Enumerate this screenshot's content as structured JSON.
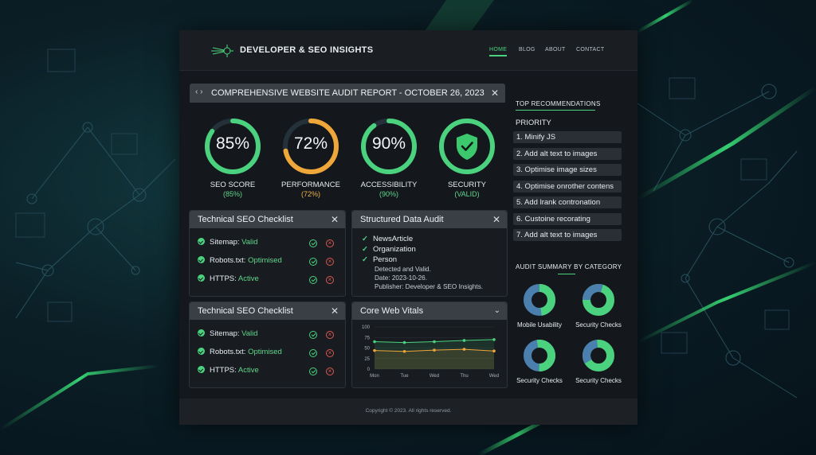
{
  "header": {
    "brand": "DEVELOPER & SEO INSIGHTS",
    "nav": [
      "HOME",
      "BLOG",
      "ABOUT",
      "CONTACT"
    ],
    "active_nav": "HOME"
  },
  "report": {
    "title": "COMPREHENSIVE WEBSITE AUDIT REPORT - OCTOBER 26, 2023",
    "gauges": [
      {
        "value": "85%",
        "label": "SEO SCORE",
        "sub": "(85%)",
        "percent": 85,
        "color": "#4ad27e"
      },
      {
        "value": "72%",
        "label": "PERFORMANCE",
        "sub": "(72%)",
        "percent": 72,
        "color": "#f0a73a"
      },
      {
        "value": "90%",
        "label": "ACCESSIBILITY",
        "sub": "(90%)",
        "percent": 90,
        "color": "#4ad27e"
      },
      {
        "value": "",
        "label": "SECURITY",
        "sub": "(VALID)",
        "percent": 100,
        "color": "#4ad27e"
      }
    ]
  },
  "checklist1": {
    "title": "Technical SEO Checklist",
    "items": [
      {
        "name": "Sitemap:",
        "status": "Valid"
      },
      {
        "name": "Robots.txt:",
        "status": "Optimised"
      },
      {
        "name": "HTTPS:",
        "status": "Active"
      }
    ]
  },
  "checklist2": {
    "title": "Technical SEO Checklist",
    "items": [
      {
        "name": "Sitemap:",
        "status": "Valid"
      },
      {
        "name": "Robots.txt:",
        "status": "Optimised"
      },
      {
        "name": "HTTPS:",
        "status": "Active"
      }
    ]
  },
  "structured": {
    "title": "Structured Data Audit",
    "items": [
      "NewsArticle",
      "Organization",
      "Person"
    ],
    "detected": "Detected and Valid.",
    "date": "Date: 2023-10-26.",
    "publisher": "Publisher: Developer & SEO Insights."
  },
  "cwv": {
    "title": "Core Web Vitals"
  },
  "chart_data": {
    "type": "line",
    "categories": [
      "Mon",
      "Tue",
      "Wed",
      "Thu",
      "Wed"
    ],
    "series": [
      {
        "values": [
          65,
          63,
          65,
          68,
          70
        ],
        "color": "#4ad27e"
      },
      {
        "values": [
          44,
          42,
          45,
          47,
          43
        ],
        "color": "#f0a73a"
      }
    ],
    "yticks": [
      "100",
      "75",
      "50",
      "25",
      "0"
    ],
    "ylim": [
      0,
      100
    ]
  },
  "recommendations": {
    "title": "TOP RECOMMENDATIONS",
    "priority": "PRIORITY",
    "items": [
      "1. Minify JS",
      "2. Add alt text to images",
      "3. Optimise image sizes",
      "4. Optimise onrother contens",
      "5. Add lrank contronation",
      "6. Custoine recorating",
      "7. Add alt text to images"
    ]
  },
  "summary": {
    "title": "AUDIT SUMMARY BY CATEGORY",
    "labels": [
      "Mobile Usability",
      "Security Checks",
      "Security Checks",
      "Security Checks"
    ]
  },
  "footer": {
    "text": "Copyright © 2023. All rights reserved."
  },
  "colors": {
    "accent": "#4ad27e",
    "warning": "#f0a73a",
    "error": "#e0574f",
    "donut_blue": "#4a7fae"
  }
}
